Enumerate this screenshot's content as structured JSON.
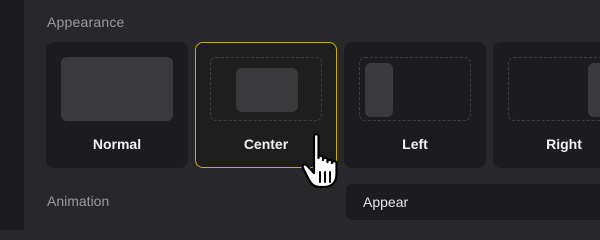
{
  "appearance": {
    "title": "Appearance",
    "options": [
      {
        "label": "Normal",
        "selected": false
      },
      {
        "label": "Center",
        "selected": true
      },
      {
        "label": "Left",
        "selected": false
      },
      {
        "label": "Right",
        "selected": false
      }
    ]
  },
  "animation": {
    "label": "Animation",
    "selected_value": "Appear"
  },
  "colors": {
    "background": "#28282b",
    "card": "#1c1c1f",
    "selected_border": "#d1a91b",
    "preview_fill": "#3a3a3d",
    "text_primary": "#f1f1f3",
    "text_secondary": "#9a9a9e"
  },
  "cursor": {
    "icon": "hand-pointer-icon"
  }
}
